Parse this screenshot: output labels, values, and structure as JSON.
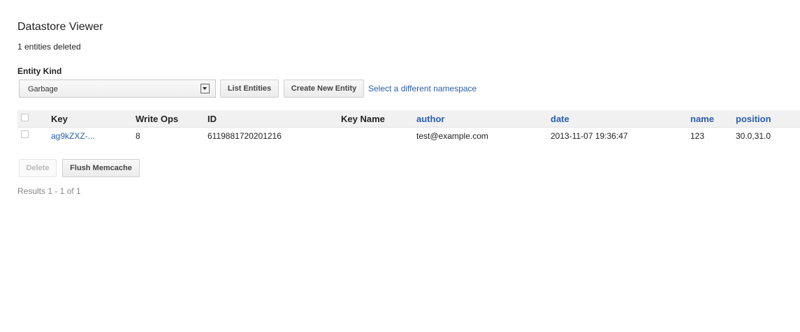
{
  "page": {
    "title": "Datastore Viewer",
    "status": "1 entities deleted"
  },
  "entity_kind": {
    "label": "Entity Kind",
    "selected": "Garbage"
  },
  "buttons": {
    "list_entities": "List Entities",
    "create_new_entity": "Create New Entity",
    "delete": "Delete",
    "flush_memcache": "Flush Memcache"
  },
  "links": {
    "namespace": "Select a different namespace"
  },
  "table": {
    "columns": [
      "Key",
      "Write Ops",
      "ID",
      "Key Name",
      "author",
      "date",
      "name",
      "position"
    ],
    "rows": [
      {
        "key": "ag9kZXZ-...",
        "write_ops": "8",
        "id": "6119881720201216",
        "key_name": "",
        "author": "test@example.com",
        "date": "2013-11-07 19:36:47",
        "name": "123",
        "position": "30.0,31.0"
      }
    ]
  },
  "results": "Results 1 - 1 of 1"
}
